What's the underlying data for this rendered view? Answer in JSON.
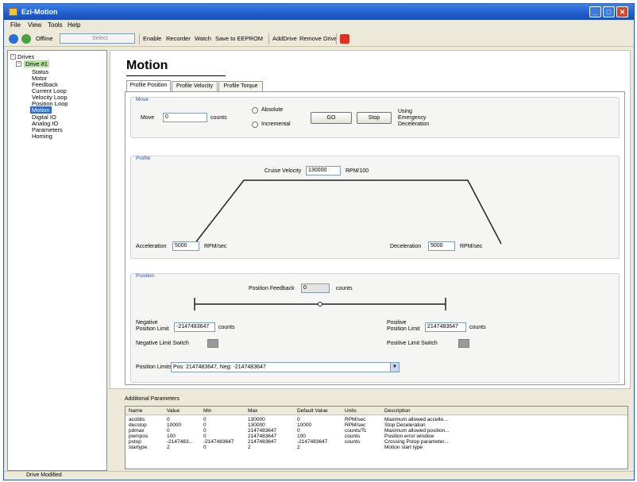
{
  "window": {
    "title": "Ezi-Motion"
  },
  "menu": [
    "File",
    "View",
    "Tools",
    "Help"
  ],
  "toolbar": {
    "status": "Offline",
    "combo_value": "Select",
    "buttons": [
      "Enable",
      "Recorder",
      "Watch",
      "Save to EEPROM",
      "AddDrive",
      "Remove Drive"
    ]
  },
  "tree": {
    "root": "Drives",
    "drive": "Drive #1",
    "items": [
      "Status",
      "Motor",
      "Feedback",
      "Current Loop",
      "Velocity Loop",
      "Position Loop",
      "Motion",
      "Digital IO",
      "Analog IO",
      "Parameters",
      "Homing"
    ],
    "selected": "Motion"
  },
  "motion": {
    "heading": "Motion",
    "tabs": [
      "Profile Position",
      "Profile Velocity",
      "Profile Torque"
    ],
    "move": {
      "group_label": "Move",
      "move_label": "Move",
      "move_value": "0",
      "units": "counts",
      "absolute_label": "Absolute",
      "incremental_label": "Incremental",
      "go_label": "GO",
      "stop_label": "Stop",
      "note": "Using Emergency Deceleration"
    },
    "profile": {
      "group_label": "Profile",
      "cruise_label": "Cruise Velocity",
      "cruise_value": "130000",
      "cruise_units": "RPM/100",
      "accel_label": "Acceleration",
      "accel_value": "5000",
      "accel_units": "RPM/sec",
      "decel_label": "Deceleration",
      "decel_value": "5000",
      "decel_units": "RPM/sec"
    },
    "position": {
      "group_label": "Position",
      "feedback_label": "Position Feedback",
      "feedback_value": "0",
      "feedback_units": "counts",
      "neg_limit_label": "Negative Position Limit",
      "neg_limit_value": "-2147483647",
      "neg_limit_units": "counts",
      "pos_limit_label": "Positive Position Limit",
      "pos_limit_value": "2147483647",
      "pos_limit_units": "counts",
      "neg_switch_label": "Negative Limit Switch",
      "pos_switch_label": "Positive Limit Switch",
      "limits_label": "Position Limits",
      "limits_value": "Pos: 2147483647, Neg: -2147483647"
    }
  },
  "params": {
    "title": "Additional Parameters",
    "columns": [
      "Name",
      "Value",
      "Min",
      "Max",
      "Default Value",
      "Units",
      "Description"
    ],
    "rows": [
      [
        "accbits",
        "0",
        "0",
        "130000",
        "0",
        "RPM/sec",
        "Maximum allowed accelle..."
      ],
      [
        "decstop",
        "10000",
        "0",
        "130000",
        "10000",
        "RPM/sec",
        "Stop Deceleration"
      ],
      [
        "pdmax",
        "0",
        "0",
        "2147483647",
        "0",
        "counts/Tc",
        "Maximum allowed position..."
      ],
      [
        "pwmpos",
        "100",
        "0",
        "2147483647",
        "100",
        "counts",
        "Position error window"
      ],
      [
        "pstop",
        "-2147483...",
        "-2147483647",
        "2147483647",
        "-2147483647",
        "counts",
        "Crossing Pstop parameter..."
      ],
      [
        "startype",
        "2",
        "0",
        "2",
        "2",
        "",
        "Motion start type"
      ]
    ]
  },
  "status": {
    "text": "Drive Modified"
  }
}
